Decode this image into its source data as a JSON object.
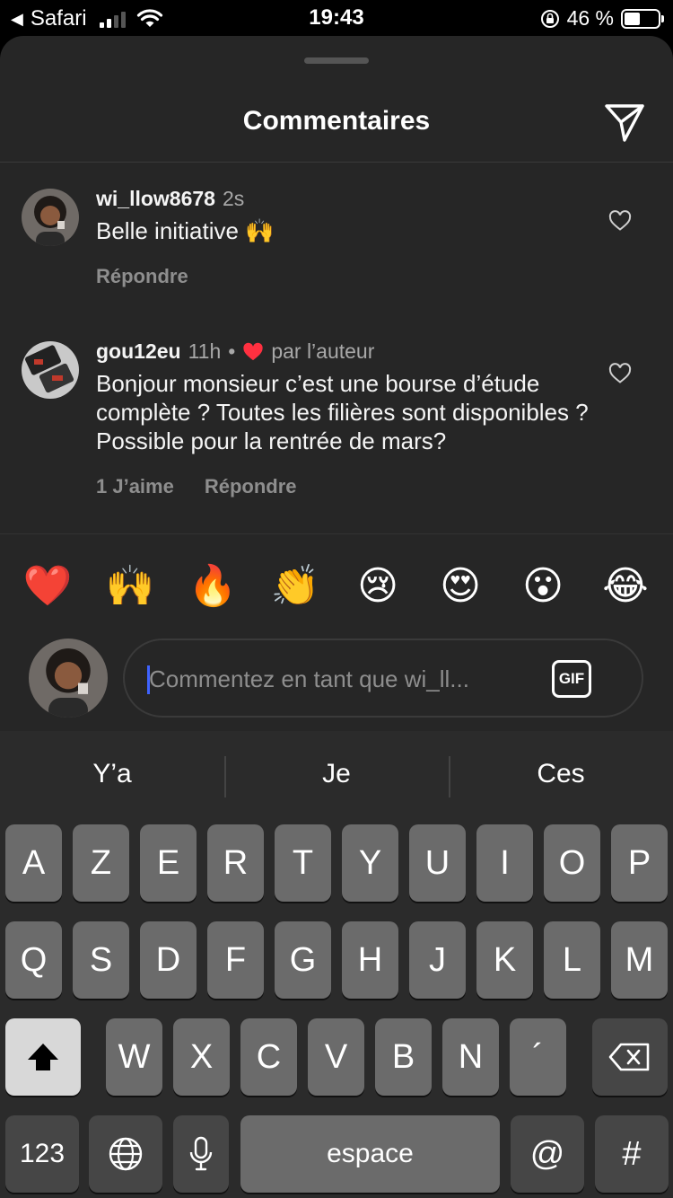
{
  "status_bar": {
    "back_app": "Safari",
    "time": "19:43",
    "battery_pct": "46 %",
    "battery_level": 0.46
  },
  "sheet": {
    "title": "Commentaires"
  },
  "comments": [
    {
      "username": "wi_llow8678",
      "time": "2s",
      "text": "Belle initiative 🙌",
      "actions": [
        "Répondre"
      ]
    },
    {
      "username": "gou12eu",
      "time": "11h",
      "separator": "•",
      "liked_by_author": "par l’auteur",
      "text": "Bonjour monsieur c’est une bourse d’étude complète ? Toutes les filières sont disponibles ? Possible pour la rentrée de mars?",
      "actions": [
        "1 J’aime",
        "Répondre"
      ]
    }
  ],
  "reactions": [
    "❤️",
    "🙌",
    "🔥",
    "👏",
    "😢",
    "😍",
    "😮",
    "😂"
  ],
  "composer": {
    "placeholder": "Commentez en tant que wi_ll...",
    "gif_label": "GIF"
  },
  "keyboard": {
    "suggestions": [
      "Y’a",
      "Je",
      "Ces"
    ],
    "row1": [
      "A",
      "Z",
      "E",
      "R",
      "T",
      "Y",
      "U",
      "I",
      "O",
      "P"
    ],
    "row2": [
      "Q",
      "S",
      "D",
      "F",
      "G",
      "H",
      "J",
      "K",
      "L",
      "M"
    ],
    "row3": [
      "W",
      "X",
      "C",
      "V",
      "B",
      "N",
      "´"
    ],
    "numbers_key": "123",
    "space_key": "espace",
    "at_key": "@",
    "hash_key": "#"
  }
}
